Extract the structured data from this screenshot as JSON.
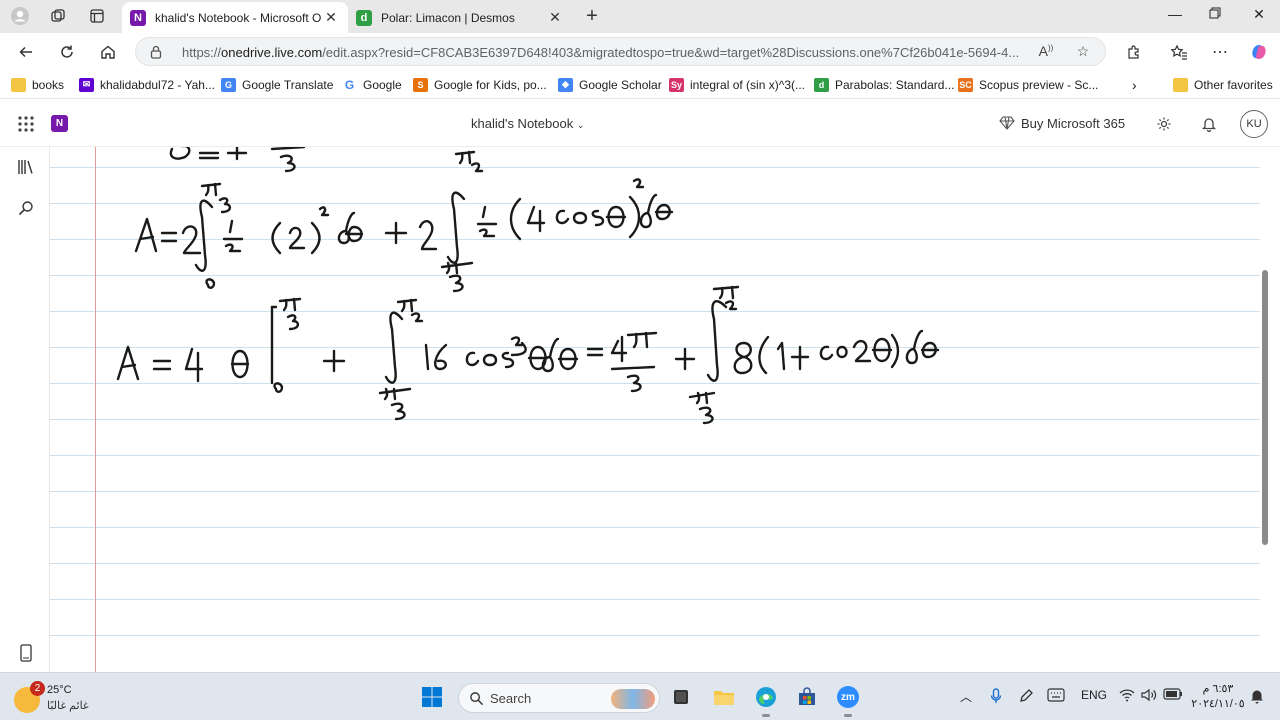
{
  "tabs": [
    {
      "title": "khalid's Notebook - Microsoft On",
      "favicon_letter": "N",
      "favicon_color": "#7719aa",
      "active": true
    },
    {
      "title": "Polar: Limacon | Desmos",
      "favicon_letter": "d",
      "favicon_color": "#2f9e44",
      "active": false
    }
  ],
  "address": {
    "url_prefix": "https://",
    "url_host": "onedrive.live.com",
    "url_rest": "/edit.aspx?resid=CF8CAB3E6397D648!403&migratedtospo=true&wd=target%28Discussions.one%7Cf26b041e-5694-4..."
  },
  "favorites": [
    {
      "label": "books",
      "icon": "folder-icon"
    },
    {
      "label": "khalidabdul72 - Yah...",
      "icon": "mail-icon",
      "color": "#6001d2"
    },
    {
      "label": "Google Translate",
      "icon": "translate-icon",
      "color": "#4285f4"
    },
    {
      "label": "Google",
      "icon": "google-icon",
      "color": "#4285f4"
    },
    {
      "label": "Google for Kids, po...",
      "icon": "kids-icon",
      "color": "#e8710a"
    },
    {
      "label": "Google Scholar",
      "icon": "scholar-icon",
      "color": "#4285f4"
    },
    {
      "label": "integral of (sin x)^3(...",
      "icon": "symbolab-icon",
      "color": "#d6336c"
    },
    {
      "label": "Parabolas: Standard...",
      "icon": "desmos-icon",
      "color": "#2f9e44"
    },
    {
      "label": "Scopus preview - Sc...",
      "icon": "scopus-icon",
      "color": "#e9711c"
    },
    {
      "label": "Other favorites",
      "icon": "folder-icon"
    }
  ],
  "onenote": {
    "logo_letter": "N",
    "notebook_title": "khalid's Notebook",
    "buy_label": "Buy Microsoft 365",
    "avatar_initials": "KU"
  },
  "taskbar": {
    "weather_badge": "2",
    "temperature": "25°C",
    "weather_desc": "غائم غالبًا",
    "search_label": "Search",
    "zoom_label": "zm",
    "language": "ENG",
    "time": "٦:٥٣ م",
    "date": "٢٠٢٤/١١/٠٥"
  },
  "colors": {
    "onenote_purple": "#7719aa",
    "ink": "#1a1a1a",
    "margin_line": "#e59a9a",
    "rule_line": "#cfe0ea"
  }
}
